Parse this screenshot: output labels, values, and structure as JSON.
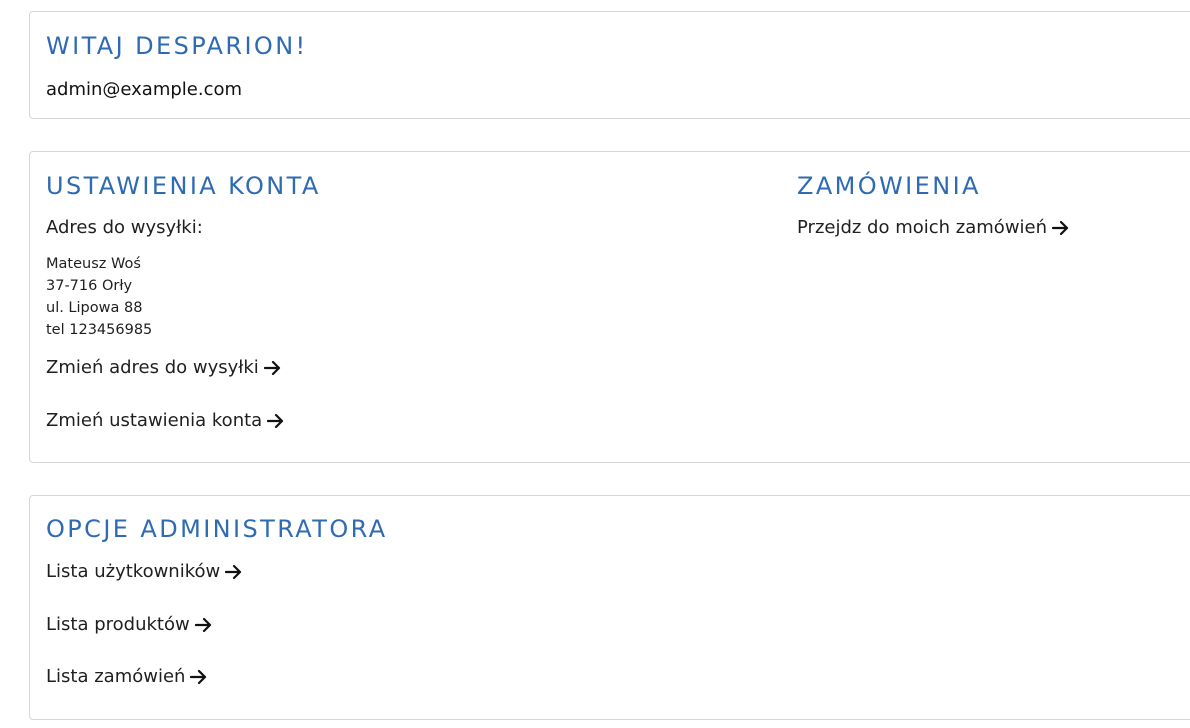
{
  "welcome": {
    "title": "WITAJ DESPARION!",
    "email": "admin@example.com"
  },
  "account": {
    "title": "USTAWIENIA KONTA",
    "shipping_label": "Adres do wysyłki:",
    "address": {
      "name": "Mateusz Woś",
      "city": "37-716 Orły",
      "street": "ul. Lipowa 88",
      "phone": "tel 123456985"
    },
    "change_address_link": "Zmień adres do wysyłki",
    "change_settings_link": "Zmień ustawienia konta"
  },
  "orders": {
    "title": "ZAMÓWIENIA",
    "my_orders_link": "Przejdz do moich zamówień"
  },
  "admin": {
    "title": "OPCJE ADMINISTRATORA",
    "links": [
      "Lista użytkowników",
      "Lista produktów",
      "Lista zamówień"
    ]
  },
  "icons": {
    "link_arrow": "arrow-right-icon"
  },
  "colors": {
    "heading": "#2f6bb3",
    "border": "#d7d7d7"
  }
}
